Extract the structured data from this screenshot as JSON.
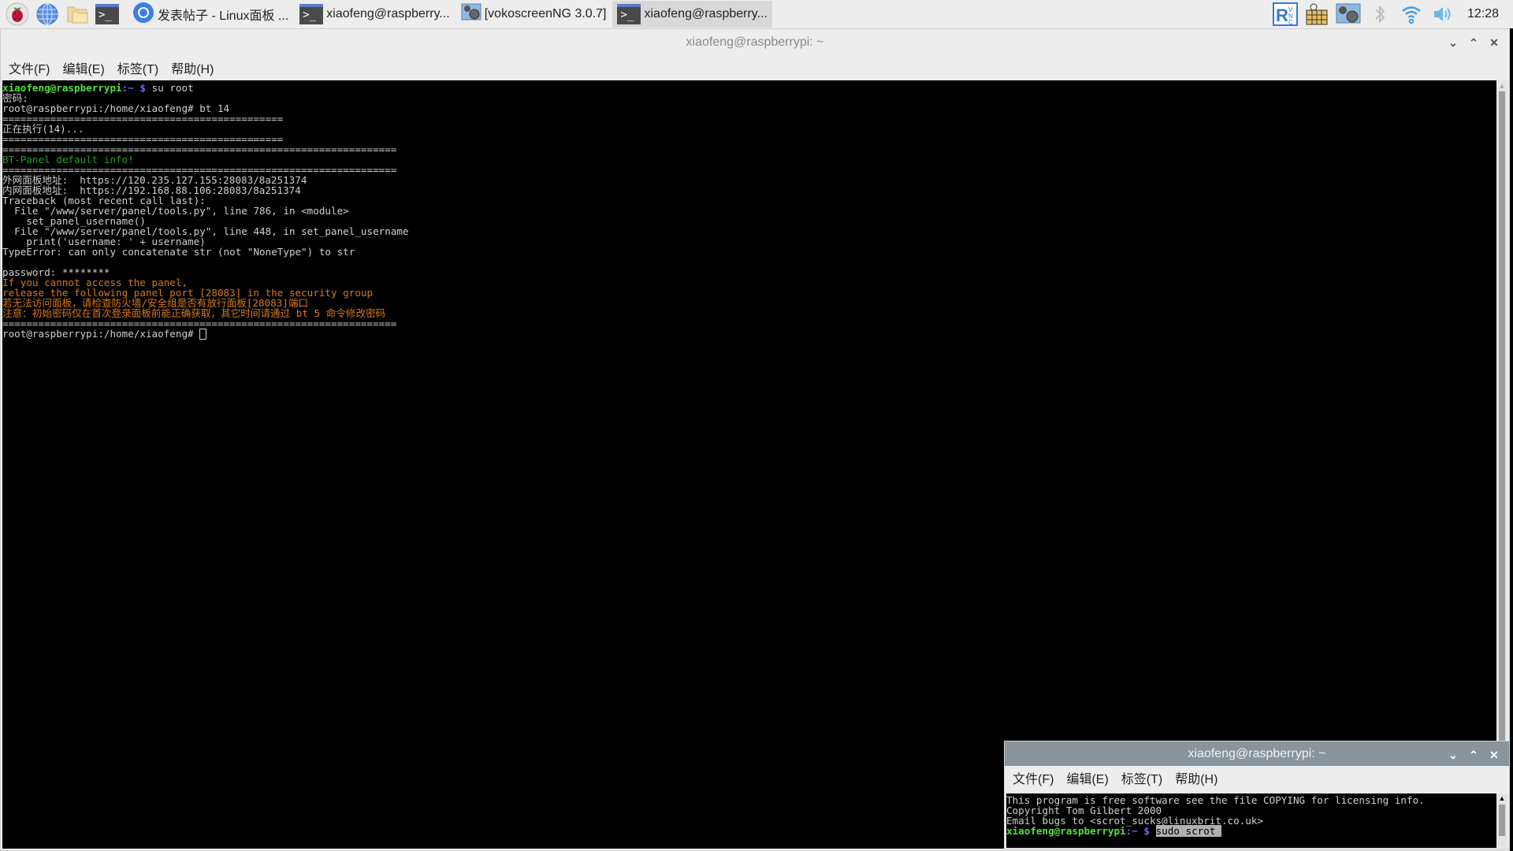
{
  "taskbar": {
    "launchers": [
      {
        "name": "raspberry-menu-icon"
      },
      {
        "name": "web-browser-icon"
      },
      {
        "name": "file-manager-icon"
      },
      {
        "name": "terminal-icon"
      }
    ],
    "tasks": [
      {
        "label": "发表帖子 - Linux面板 ...",
        "icon": "chromium-icon",
        "active": false
      },
      {
        "label": "xiaofeng@raspberry...",
        "icon": "terminal-icon",
        "active": false
      },
      {
        "label": "[vokoscreenNG 3.0.7]",
        "icon": "vokoscreen-icon",
        "active": false
      },
      {
        "label": "xiaofeng@raspberry...",
        "icon": "terminal-icon",
        "active": true
      }
    ],
    "tray": {
      "icons": [
        "vnc-icon",
        "keyboard-icon",
        "vokoscreen-tray-icon",
        "bluetooth-icon",
        "wifi-icon",
        "volume-icon"
      ],
      "clock": "12:28"
    }
  },
  "main_window": {
    "title": "xiaofeng@raspberrypi: ~",
    "menu": [
      "文件(F)",
      "编辑(E)",
      "标签(T)",
      "帮助(H)"
    ],
    "terminal": {
      "prompt_user": "xiaofeng@raspberrypi",
      "prompt_path": ":~",
      "prompt_sym": " $",
      "cmd1": " su root",
      "lines": [
        "密码:",
        "root@raspberrypi:/home/xiaofeng# bt 14",
        "===============================================",
        "正在执行(14)...",
        "===============================================",
        "=================================================================="
      ],
      "bt_info": "BT-Panel default info!",
      "sep_long": "==================================================================",
      "output": [
        "外网面板地址:  https://120.235.127.155:28083/8a251374",
        "内网面板地址:  https://192.168.88.106:28083/8a251374",
        "Traceback (most recent call last):",
        "  File \"/www/server/panel/tools.py\", line 786, in <module>",
        "    set_panel_username()",
        "  File \"/www/server/panel/tools.py\", line 448, in set_panel_username",
        "    print('username: ' + username)",
        "TypeError: can only concatenate str (not \"NoneType\") to str",
        "",
        "password: ********"
      ],
      "warnings": [
        "If you cannot access the panel,",
        "release the following panel port [28083] in the security group",
        "若无法访问面板，请检查防火墙/安全组是否有放行面板[28083]端口",
        "注意：初始密码仅在首次登录面板前能正确获取，其它时间请通过 bt 5 命令修改密码"
      ],
      "final_prompt": "root@raspberrypi:/home/xiaofeng# "
    }
  },
  "small_window": {
    "title": "xiaofeng@raspberrypi: ~",
    "menu": [
      "文件(F)",
      "编辑(E)",
      "标签(T)",
      "帮助(H)"
    ],
    "terminal": {
      "lines": [
        "This program is free software see the file COPYING for licensing info.",
        "Copyright Tom Gilbert 2000",
        "Email bugs to <scrot_sucks@linuxbrit.co.uk>"
      ],
      "prompt_user": "xiaofeng@raspberrypi",
      "prompt_path": ":~",
      "prompt_sym": " $ ",
      "selected_cmd": "sudo scrot "
    }
  },
  "window_controls": {
    "minimize": "⌄",
    "maximize": "⌃",
    "close": "✕"
  }
}
